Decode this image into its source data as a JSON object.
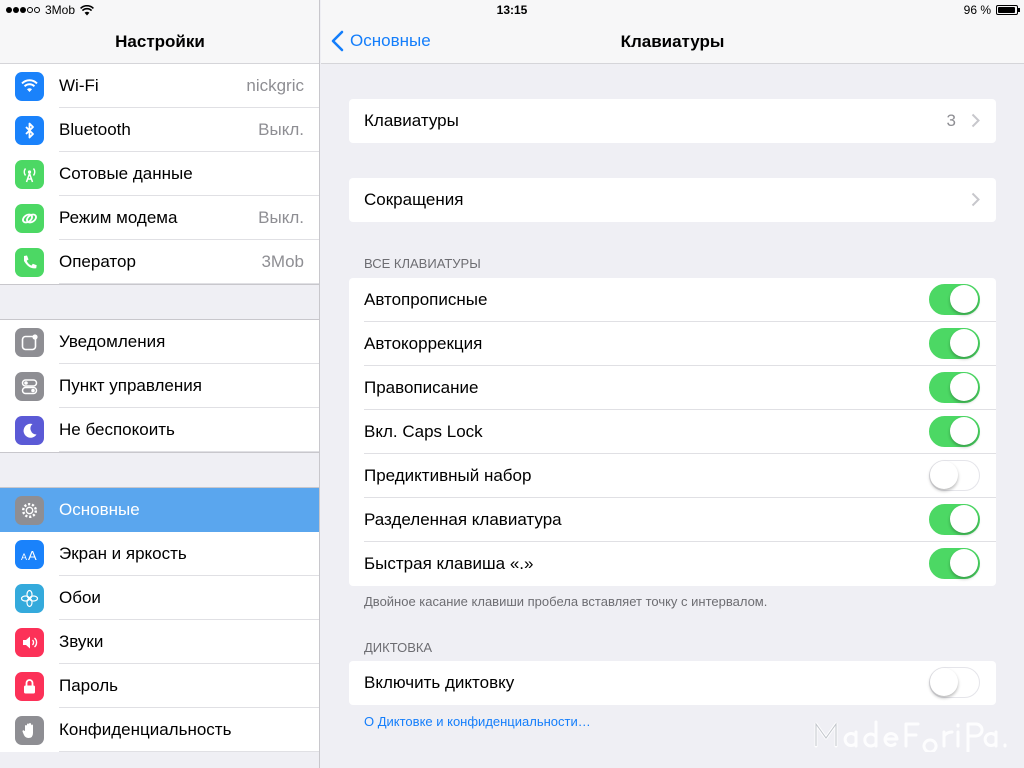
{
  "status_bar": {
    "carrier": "3Mob",
    "time": "13:15",
    "battery_text": "96 %",
    "battery_level": 0.96,
    "signal_bars": 5,
    "signal_filled": 3
  },
  "sidebar": {
    "title": "Настройки",
    "group_top": [
      {
        "label": "Wi-Fi",
        "value": "nickgric",
        "icon": "wifi-icon",
        "color": "#1a82fb"
      },
      {
        "label": "Bluetooth",
        "value": "Выкл.",
        "icon": "bluetooth-icon",
        "color": "#1a82fb"
      },
      {
        "label": "Сотовые данные",
        "value": "",
        "icon": "antenna-icon",
        "color": "#4cd864"
      },
      {
        "label": "Режим модема",
        "value": "Выкл.",
        "icon": "link-icon",
        "color": "#4cd864"
      },
      {
        "label": "Оператор",
        "value": "3Mob",
        "icon": "phone-icon",
        "color": "#4cd864"
      }
    ],
    "group_mid": [
      {
        "label": "Уведомления",
        "icon": "notifications-icon",
        "color": "#8e8e93"
      },
      {
        "label": "Пункт управления",
        "icon": "control-center-icon",
        "color": "#8e8e93"
      },
      {
        "label": "Не беспокоить",
        "icon": "moon-icon",
        "color": "#5b5ad6"
      }
    ],
    "group_bottom": [
      {
        "label": "Основные",
        "icon": "gear-icon",
        "color": "#8e8e93",
        "selected": true
      },
      {
        "label": "Экран и яркость",
        "icon": "text-size-icon",
        "color": "#1a82fb"
      },
      {
        "label": "Обои",
        "icon": "flower-icon",
        "color": "#34aadc"
      },
      {
        "label": "Звуки",
        "icon": "speaker-icon",
        "color": "#fc3158"
      },
      {
        "label": "Пароль",
        "icon": "lock-icon",
        "color": "#fc3158"
      },
      {
        "label": "Конфиденциальность",
        "icon": "hand-icon",
        "color": "#8e8e93"
      }
    ]
  },
  "detail": {
    "back_label": "Основные",
    "title": "Клавиатуры",
    "keyboards": {
      "label": "Клавиатуры",
      "value": "3"
    },
    "shortcuts": {
      "label": "Сокращения"
    },
    "all_keyboards_header": "Все клавиатуры",
    "toggles": [
      {
        "label": "Автопрописные",
        "on": true
      },
      {
        "label": "Автокоррекция",
        "on": true
      },
      {
        "label": "Правописание",
        "on": true
      },
      {
        "label": "Вкл. Caps Lock",
        "on": true
      },
      {
        "label": "Предиктивный набор",
        "on": false
      },
      {
        "label": "Разделенная клавиатура",
        "on": true
      },
      {
        "label": "Быстрая клавиша «.»",
        "on": true
      }
    ],
    "footer_note": "Двойное касание клавиши пробела вставляет точку с интервалом.",
    "dictation_header": "Диктовка",
    "dictation": {
      "label": "Включить диктовку",
      "on": false
    },
    "dictation_link": "О Диктовке и конфиденциальности…"
  },
  "watermark": "MadeForiPad.ru",
  "colors": {
    "accent": "#147efb",
    "toggle_on": "#4cd864",
    "selected_row": "#5aa6ee",
    "background": "#efeff4"
  }
}
